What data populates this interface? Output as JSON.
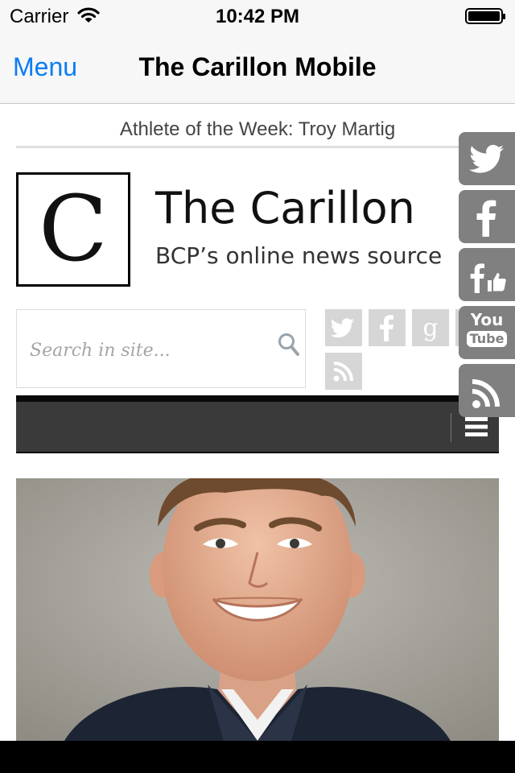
{
  "status_bar": {
    "carrier": "Carrier",
    "time": "10:42 PM"
  },
  "nav_bar": {
    "menu_label": "Menu",
    "title": "The Carillon Mobile",
    "accent_color": "#0a7cf5"
  },
  "ticker": {
    "text": "Athlete of the Week: Troy Martig"
  },
  "logo": {
    "letter": "C",
    "title": "The Carillon",
    "tagline": "BCP’s online news source"
  },
  "search": {
    "placeholder": "Search in site..."
  },
  "social_icons": [
    "twitter-icon",
    "facebook-icon",
    "google-plus-icon",
    "youtube-icon",
    "rss-icon"
  ],
  "share_bar": {
    "youtube_top": "You",
    "youtube_bottom": "Tube",
    "items": [
      "twitter-icon",
      "facebook-icon",
      "facebook-like-icon",
      "youtube-icon",
      "rss-icon"
    ]
  },
  "nav_strip": {
    "icon": "hamburger-icon"
  },
  "article": {
    "image": "athlete-portrait-photo"
  }
}
